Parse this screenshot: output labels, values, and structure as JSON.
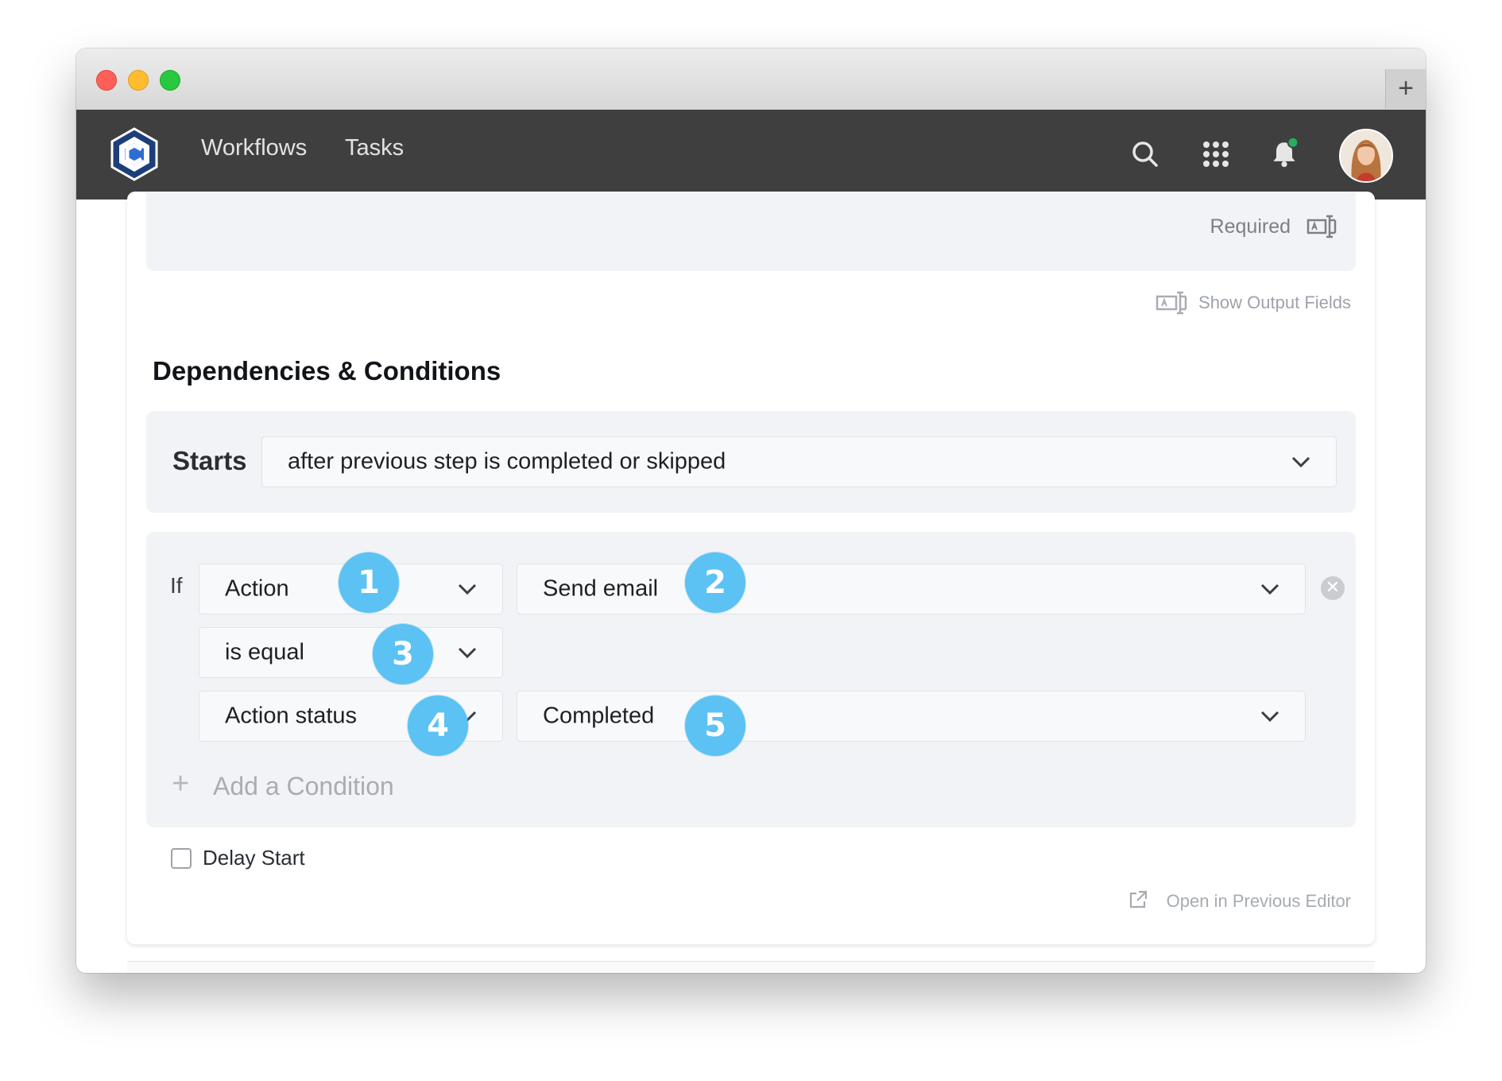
{
  "window": {
    "newtab_symbol": "+"
  },
  "nav": {
    "links": [
      "Workflows",
      "Tasks"
    ],
    "icons": [
      "search-icon",
      "apps-grid-icon",
      "bell-icon",
      "avatar"
    ],
    "notification_dot_color": "#27ae60",
    "bg_color": "#3f3f3f"
  },
  "step": {
    "required_label": "Required",
    "show_output_fields": "Show Output Fields",
    "section_title": "Dependencies & Conditions",
    "starts_label": "Starts",
    "starts_value": "after previous step is completed or skipped",
    "if_label": "If",
    "conditions": {
      "field": "Action",
      "field_value": "Send email",
      "operator": "is equal",
      "attribute": "Action status",
      "attribute_value": "Completed"
    },
    "add_condition": "Add a Condition",
    "delay_start": "Delay Start",
    "delay_start_checked": false,
    "open_previous_editor": "Open in Previous Editor"
  },
  "badges": [
    "1",
    "2",
    "3",
    "4",
    "5"
  ],
  "badge_color": "#5bc2f3"
}
